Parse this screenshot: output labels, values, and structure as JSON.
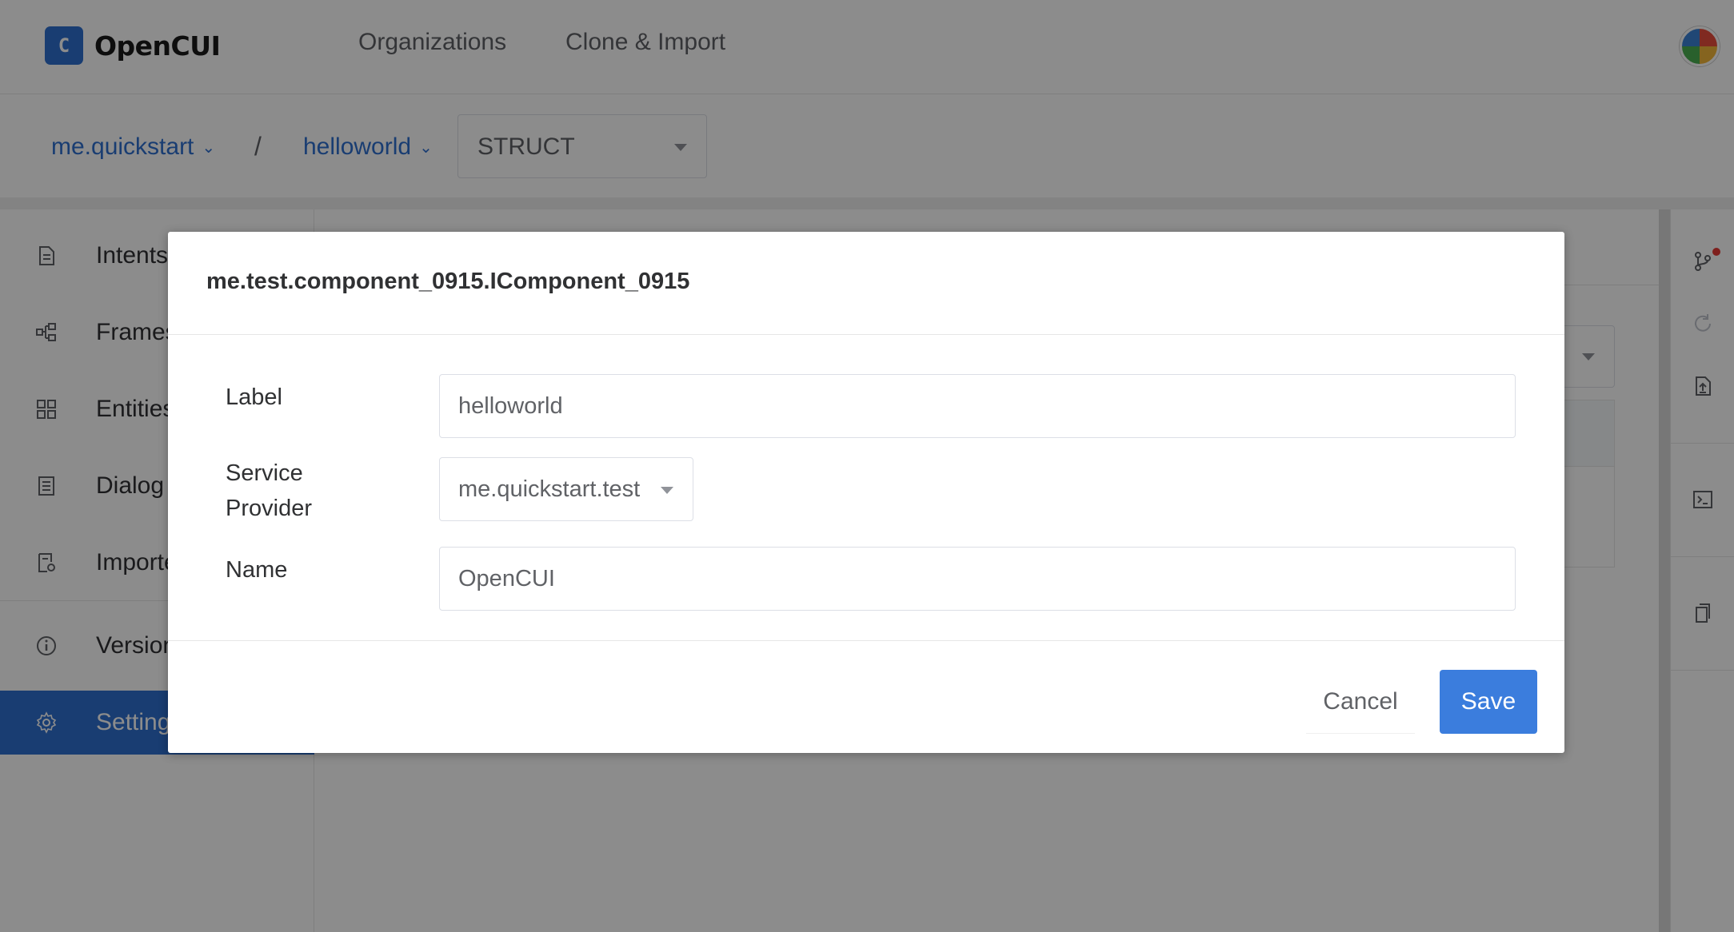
{
  "app": {
    "logo_mark": "C",
    "name": "OpenCUI"
  },
  "topnav": {
    "organizations": "Organizations",
    "clone_import": "Clone & Import"
  },
  "breadcrumb": {
    "org": "me.quickstart",
    "separator": "/",
    "project": "helloworld",
    "type_select": "STRUCT"
  },
  "sidebar": {
    "items": [
      {
        "label": "Intents",
        "icon": "document-icon"
      },
      {
        "label": "Frames",
        "icon": "frames-icon"
      },
      {
        "label": "Entities",
        "icon": "entities-icon"
      },
      {
        "label": "Dialog",
        "icon": "dialog-icon"
      },
      {
        "label": "Imported",
        "icon": "imported-icon"
      },
      {
        "label": "Versions",
        "icon": "info-icon"
      },
      {
        "label": "Settings",
        "icon": "gear-icon"
      }
    ]
  },
  "dialog": {
    "title": "me.test.component_0915.IComponent_0915",
    "label_field": {
      "label": "Label",
      "placeholder": "helloworld"
    },
    "service_provider": {
      "label_line1": "Service",
      "label_line2": "Provider",
      "value": "me.quickstart.test"
    },
    "name_field": {
      "label": "Name",
      "placeholder": "OpenCUI"
    },
    "cancel": "Cancel",
    "save": "Save"
  },
  "colors": {
    "primary": "#2f6fcf",
    "save_button": "#3b7ddd",
    "overlay": "rgba(0,0,0,0.45)"
  }
}
